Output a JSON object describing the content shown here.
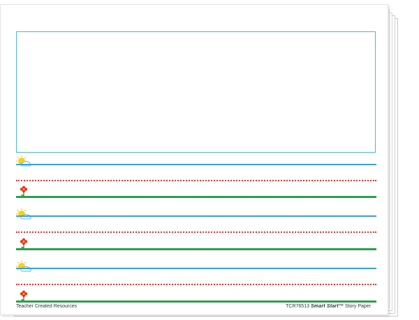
{
  "paper": {
    "publisher": "Teacher Created Resources",
    "product_code": "TCR76513",
    "brand": "Smart Start™",
    "product_name": "Story Paper"
  },
  "rows": [
    {
      "marker": "sun-cloud-icon"
    },
    {
      "marker": "flower-icon"
    },
    {
      "marker": "sun-cloud-icon"
    },
    {
      "marker": "flower-icon"
    },
    {
      "marker": "sun-cloud-icon"
    },
    {
      "marker": "flower-icon"
    }
  ],
  "colors": {
    "box_border": "#48b4e0",
    "top_line": "#3aa0d8",
    "midline": "#e0302a",
    "baseline": "#2aa048",
    "sun": "#f6d11c",
    "cloud": "#5ab8e6",
    "flower_petal": "#e8341c",
    "flower_stem": "#2aa048"
  }
}
